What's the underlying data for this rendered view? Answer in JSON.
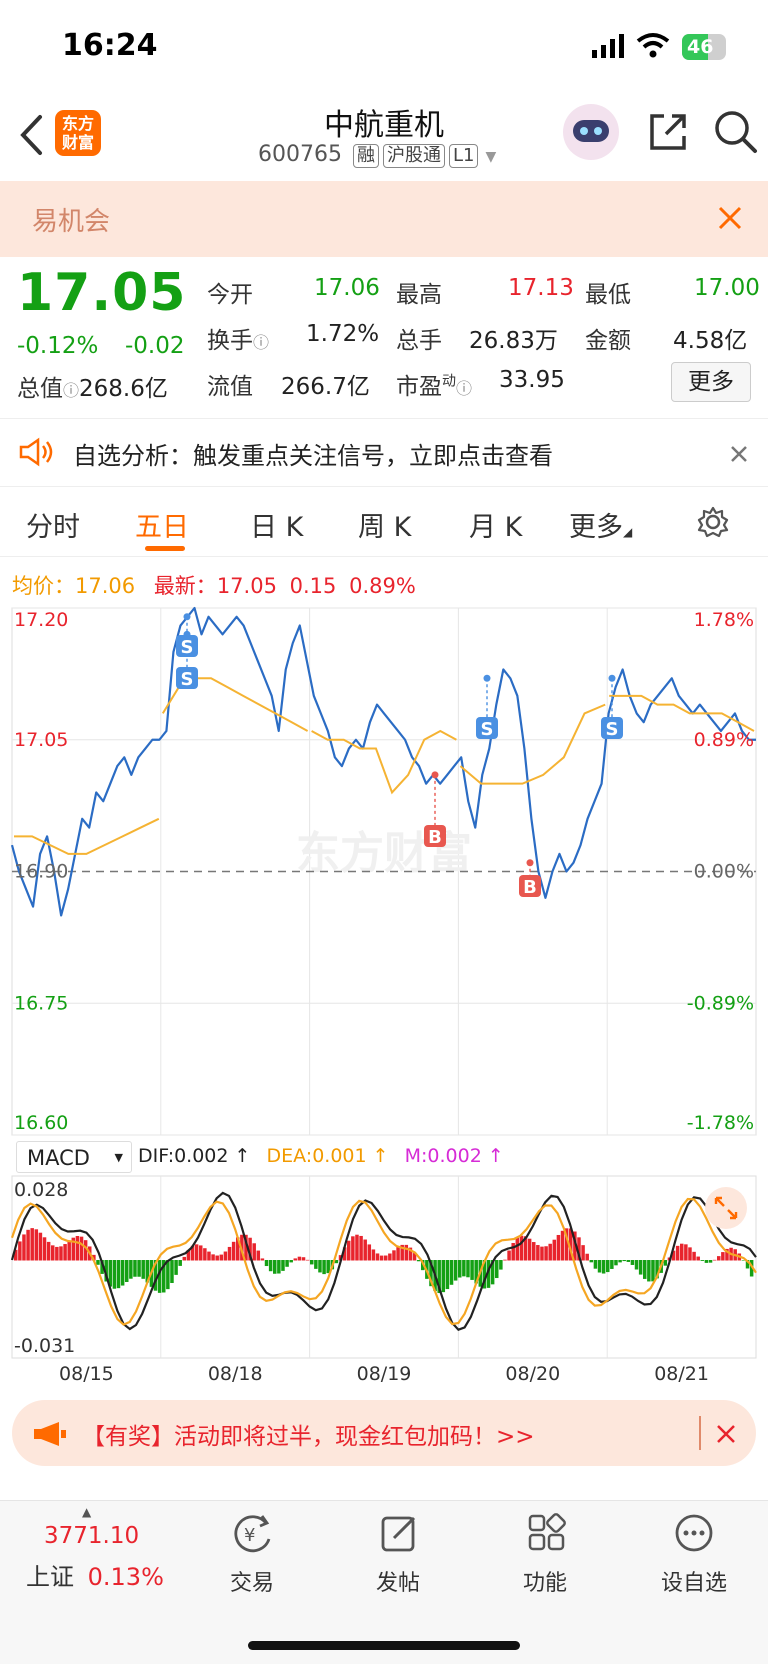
{
  "status_bar": {
    "time": "16:24",
    "battery": "46"
  },
  "header": {
    "title": "中航重机",
    "code": "600765",
    "badges": [
      "融",
      "沪股通",
      "L1"
    ],
    "logo_text": [
      "东方",
      "财富"
    ]
  },
  "banner": {
    "text": "易机会"
  },
  "quote": {
    "price": "17.05",
    "change_pct": "-0.12%",
    "change": "-0.02",
    "total_value_label": "总值",
    "total_value": "268.6亿",
    "fields": [
      {
        "label": "今开",
        "value": "17.06",
        "color": "green"
      },
      {
        "label": "最高",
        "value": "17.13",
        "color": "red"
      },
      {
        "label": "最低",
        "value": "17.00",
        "color": "green"
      },
      {
        "label": "换手",
        "value": "1.72%",
        "color": "dark"
      },
      {
        "label": "总手",
        "value": "26.83万",
        "color": "dark"
      },
      {
        "label": "金额",
        "value": "4.58亿",
        "color": "dark"
      },
      {
        "label": "流值",
        "value": "266.7亿",
        "color": "dark"
      },
      {
        "label": "市盈",
        "sup": "动",
        "value": "33.95",
        "color": "dark"
      }
    ],
    "more_button": "更多"
  },
  "notice": {
    "text": "自选分析：触发重点关注信号，立即点击查看"
  },
  "tabs": {
    "items": [
      "分时",
      "五日",
      "日 K",
      "周 K",
      "月 K",
      "更多"
    ],
    "active": 1
  },
  "legend": {
    "avg_label": "均价：",
    "avg_value": "17.06",
    "latest_label": "最新：",
    "latest_value": "17.05",
    "latest_change": "0.15",
    "latest_pct": "0.89%"
  },
  "macd": {
    "selector": "MACD",
    "dif": "DIF:0.002 ↑",
    "dea": "DEA:0.001 ↑",
    "m": "M:0.002 ↑",
    "y_max": "0.028",
    "y_min": "-0.031"
  },
  "watermark": "东方财富",
  "chart_data": {
    "type": "line",
    "title": "",
    "x_labels": [
      "08/15",
      "08/18",
      "08/19",
      "08/20",
      "08/21"
    ],
    "price_ticks_left": [
      "17.20",
      "17.05",
      "16.90",
      "16.75",
      "16.60"
    ],
    "pct_ticks_right": [
      "1.78%",
      "0.89%",
      "0.00%",
      "-0.89%",
      "-1.78%"
    ],
    "ylim": [
      16.6,
      17.2
    ],
    "reference_price": 16.9,
    "series": [
      {
        "name": "price",
        "color": "#2b6cc4",
        "values": [
          16.93,
          16.9,
          16.88,
          16.86,
          16.92,
          16.94,
          16.9,
          16.85,
          16.88,
          16.92,
          16.96,
          16.95,
          16.99,
          16.98,
          17.0,
          17.02,
          17.03,
          17.01,
          17.03,
          17.04,
          17.05,
          17.05,
          17.06,
          17.15,
          17.18,
          17.19,
          17.2,
          17.17,
          17.19,
          17.18,
          17.17,
          17.18,
          17.19,
          17.18,
          17.16,
          17.14,
          17.12,
          17.1,
          17.06,
          17.13,
          17.16,
          17.18,
          17.14,
          17.1,
          17.08,
          17.06,
          17.03,
          17.02,
          17.04,
          17.05,
          17.04,
          17.07,
          17.09,
          17.08,
          17.07,
          17.06,
          17.05,
          17.03,
          17.02,
          17.0,
          17.01,
          17.0,
          17.01,
          17.02,
          17.03,
          16.98,
          16.95,
          17.01,
          17.04,
          17.09,
          17.13,
          17.12,
          17.1,
          17.04,
          16.96,
          16.9,
          16.87,
          16.9,
          16.92,
          16.9,
          16.91,
          16.93,
          16.96,
          16.98,
          17.0,
          17.08,
          17.11,
          17.13,
          17.1,
          17.08,
          17.07,
          17.09,
          17.1,
          17.11,
          17.12,
          17.1,
          17.09,
          17.08,
          17.09,
          17.08,
          17.07,
          17.06,
          17.07,
          17.08,
          17.06,
          17.05,
          17.05
        ]
      },
      {
        "name": "average",
        "color": "#f5b333",
        "values": [
          16.94,
          16.94,
          16.93,
          16.92,
          16.92,
          16.93,
          16.94,
          16.95,
          16.96,
          17.08,
          17.11,
          17.12,
          17.12,
          17.11,
          17.1,
          17.09,
          17.08,
          17.07,
          17.06,
          17.06,
          17.05,
          17.05,
          17.04,
          17.04,
          16.99,
          17.01,
          17.05,
          17.06,
          17.05,
          17.02,
          17.0,
          17.0,
          17.0,
          17.01,
          17.03,
          17.08,
          17.09,
          17.1,
          17.1,
          17.1,
          17.09,
          17.09,
          17.08,
          17.08,
          17.08,
          17.07,
          17.06
        ]
      }
    ],
    "markers": [
      {
        "label": "S",
        "x": "08/18"
      },
      {
        "label": "S",
        "x": "08/18"
      },
      {
        "label": "B",
        "x": "08/19"
      },
      {
        "label": "S",
        "x": "08/20"
      },
      {
        "label": "B",
        "x": "08/20"
      },
      {
        "label": "S",
        "x": "08/21"
      }
    ]
  },
  "promo": {
    "text": "【有奖】活动即将过半，现金红包加码！>>"
  },
  "bottom_nav": {
    "index_value": "3771.10",
    "index_name": "上证",
    "index_pct": "0.13%",
    "items": [
      "交易",
      "发帖",
      "功能",
      "设自选"
    ]
  },
  "colors": {
    "up": "#e8242d",
    "down": "#14a014",
    "accent": "#ff6a00",
    "avg": "#f5b333",
    "price_line": "#2b6cc4"
  }
}
